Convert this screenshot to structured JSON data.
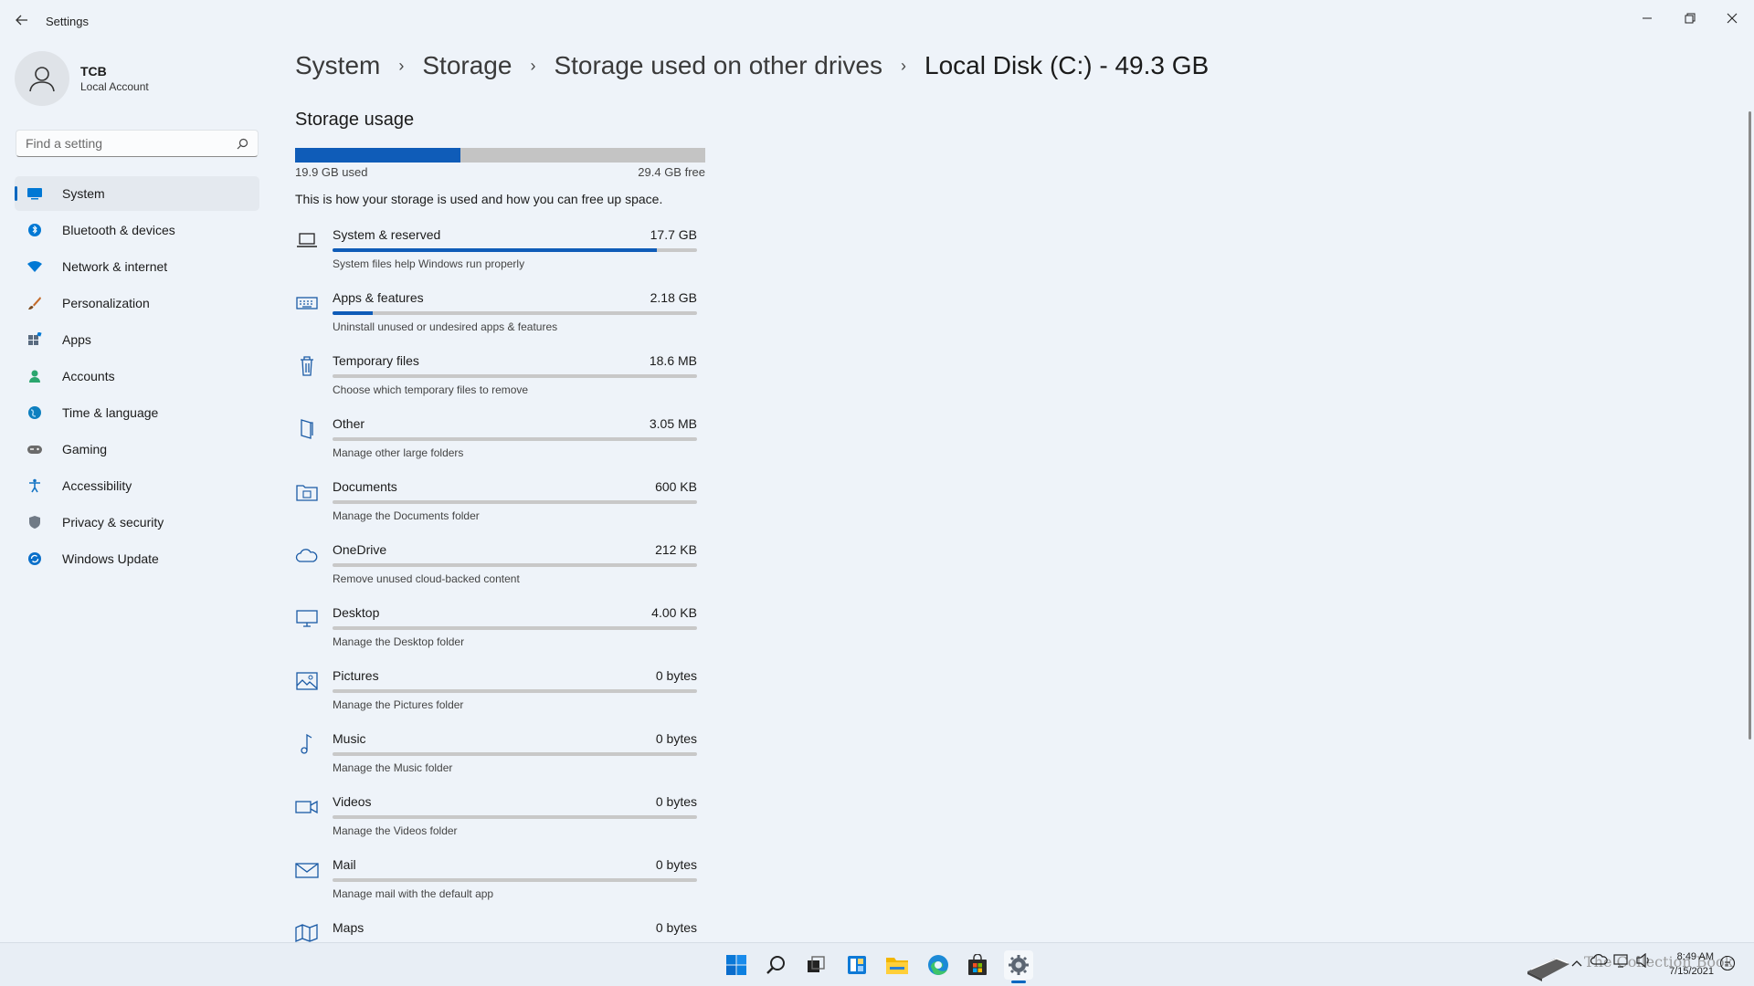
{
  "window": {
    "title": "Settings",
    "minimize": "—",
    "restore": "❐",
    "close": "✕"
  },
  "profile": {
    "name": "TCB",
    "account_type": "Local Account"
  },
  "search": {
    "placeholder": "Find a setting"
  },
  "sidebar": {
    "items": [
      {
        "label": "System",
        "icon": "system-icon",
        "active": true,
        "color": "#0078d4"
      },
      {
        "label": "Bluetooth & devices",
        "icon": "bluetooth-icon",
        "color": "#0078d4"
      },
      {
        "label": "Network & internet",
        "icon": "wifi-icon",
        "color": "#0078d4"
      },
      {
        "label": "Personalization",
        "icon": "brush-icon",
        "color": "#c46b2b"
      },
      {
        "label": "Apps",
        "icon": "apps-icon",
        "color": "#5a6b80"
      },
      {
        "label": "Accounts",
        "icon": "person-icon",
        "color": "#2aa66e"
      },
      {
        "label": "Time & language",
        "icon": "globe-icon",
        "color": "#0d7fbf"
      },
      {
        "label": "Gaming",
        "icon": "gamepad-icon",
        "color": "#6b6b6b"
      },
      {
        "label": "Accessibility",
        "icon": "accessibility-icon",
        "color": "#1474c4"
      },
      {
        "label": "Privacy & security",
        "icon": "shield-icon",
        "color": "#707a86"
      },
      {
        "label": "Windows Update",
        "icon": "update-icon",
        "color": "#0b6fc9"
      }
    ]
  },
  "breadcrumb": {
    "items": [
      "System",
      "Storage",
      "Storage used on other drives"
    ],
    "current": "Local Disk (C:) - 49.3 GB"
  },
  "storage": {
    "title": "Storage usage",
    "used_label": "19.9 GB used",
    "free_label": "29.4 GB free",
    "used_fraction": 0.404,
    "description": "This is how your storage is used and how you can free up space.",
    "accent": "#0f5cb8"
  },
  "categories": [
    {
      "name": "System & reserved",
      "size": "17.7 GB",
      "desc": "System files help Windows run properly",
      "fraction": 0.89,
      "icon": "laptop-icon"
    },
    {
      "name": "Apps & features",
      "size": "2.18 GB",
      "desc": "Uninstall unused or undesired apps & features",
      "fraction": 0.11,
      "icon": "keyboard-icon"
    },
    {
      "name": "Temporary files",
      "size": "18.6 MB",
      "desc": "Choose which temporary files to remove",
      "fraction": 0.0,
      "icon": "trash-icon"
    },
    {
      "name": "Other",
      "size": "3.05 MB",
      "desc": "Manage other large folders",
      "fraction": 0.0,
      "icon": "other-folder-icon"
    },
    {
      "name": "Documents",
      "size": "600 KB",
      "desc": "Manage the Documents folder",
      "fraction": 0.0,
      "icon": "documents-icon"
    },
    {
      "name": "OneDrive",
      "size": "212 KB",
      "desc": "Remove unused cloud-backed content",
      "fraction": 0.0,
      "icon": "cloud-icon"
    },
    {
      "name": "Desktop",
      "size": "4.00 KB",
      "desc": "Manage the Desktop folder",
      "fraction": 0.0,
      "icon": "monitor-icon"
    },
    {
      "name": "Pictures",
      "size": "0 bytes",
      "desc": "Manage the Pictures folder",
      "fraction": 0.0,
      "icon": "picture-icon"
    },
    {
      "name": "Music",
      "size": "0 bytes",
      "desc": "Manage the Music folder",
      "fraction": 0.0,
      "icon": "music-icon"
    },
    {
      "name": "Videos",
      "size": "0 bytes",
      "desc": "Manage the Videos folder",
      "fraction": 0.0,
      "icon": "video-icon"
    },
    {
      "name": "Mail",
      "size": "0 bytes",
      "desc": "Manage mail with the default app",
      "fraction": 0.0,
      "icon": "mail-icon"
    },
    {
      "name": "Maps",
      "size": "0 bytes",
      "desc": "",
      "fraction": 0.0,
      "icon": "map-icon"
    }
  ],
  "taskbar": {
    "apps": [
      "start-icon",
      "search-icon",
      "task-view-icon",
      "widgets-icon",
      "file-explorer-icon",
      "edge-icon",
      "store-icon",
      "settings-icon"
    ],
    "active_app": "settings-icon",
    "time": "8:49 AM",
    "date": "7/15/2021",
    "watermark": "The Collection Book"
  }
}
